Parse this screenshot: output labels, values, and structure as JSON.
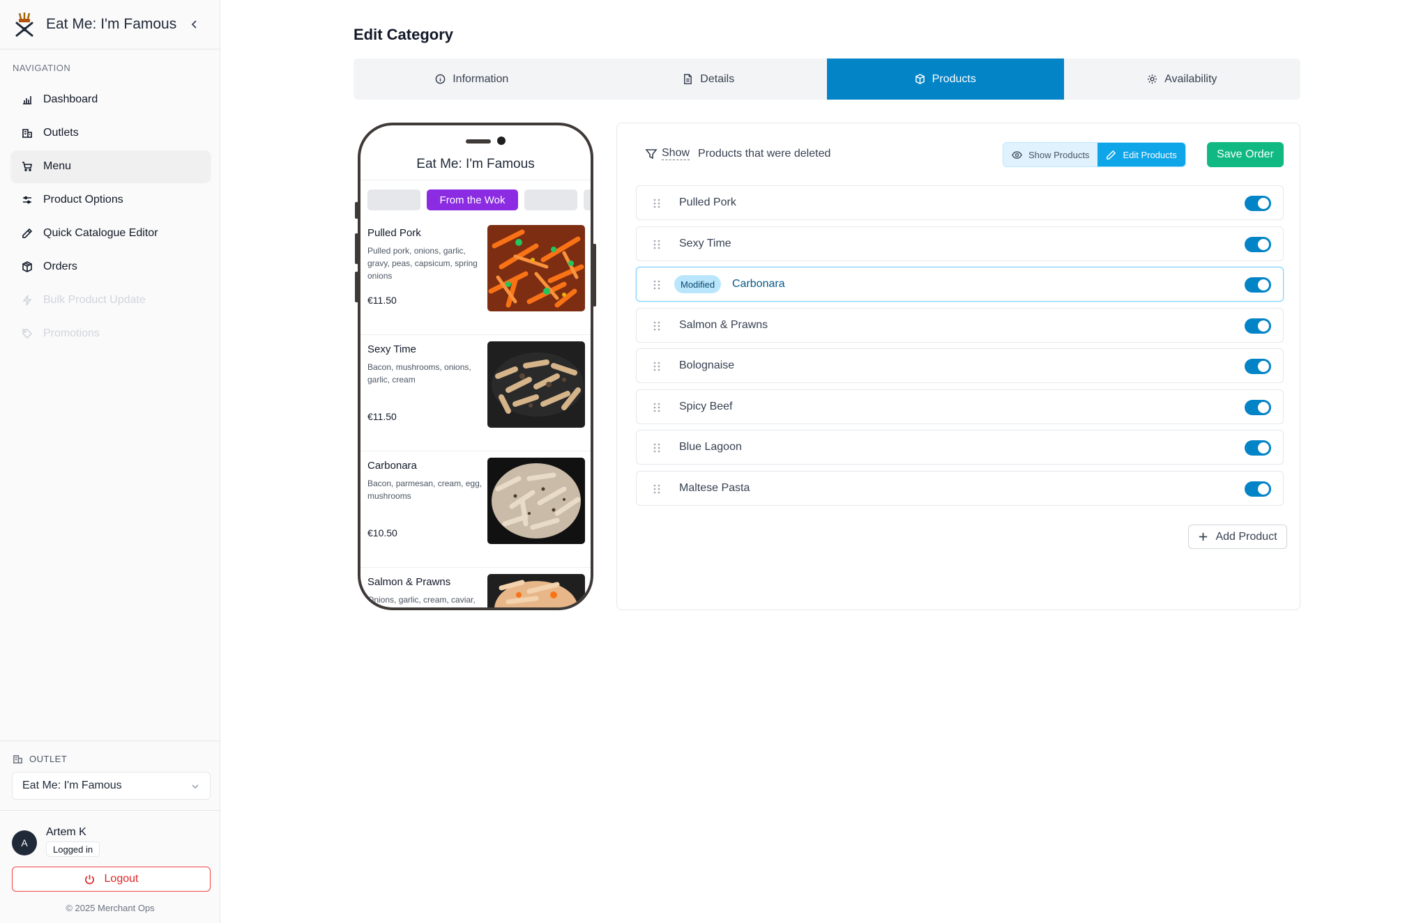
{
  "brand": {
    "title": "Eat Me: I'm Famous"
  },
  "nav": {
    "heading": "NAVIGATION",
    "items": [
      {
        "label": "Dashboard",
        "icon": "bar-chart-icon",
        "state": "normal"
      },
      {
        "label": "Outlets",
        "icon": "building-icon",
        "state": "normal"
      },
      {
        "label": "Menu",
        "icon": "cart-icon",
        "state": "active"
      },
      {
        "label": "Product Options",
        "icon": "sliders-icon",
        "state": "normal"
      },
      {
        "label": "Quick Catalogue Editor",
        "icon": "pencil-icon",
        "state": "normal"
      },
      {
        "label": "Orders",
        "icon": "package-icon",
        "state": "normal"
      },
      {
        "label": "Bulk Product Update",
        "icon": "lightning-icon",
        "state": "disabled"
      },
      {
        "label": "Promotions",
        "icon": "tag-icon",
        "state": "disabled"
      }
    ]
  },
  "outlet": {
    "label": "OUTLET",
    "selected": "Eat Me: I'm Famous"
  },
  "user": {
    "initial": "A",
    "name": "Artem K",
    "status": "Logged in",
    "logout_label": "Logout"
  },
  "footer": {
    "copyright": "© 2025 Merchant Ops"
  },
  "page": {
    "title": "Edit Category"
  },
  "tabs": [
    {
      "label": "Information",
      "icon": "info-icon",
      "active": false
    },
    {
      "label": "Details",
      "icon": "document-icon",
      "active": false
    },
    {
      "label": "Products",
      "icon": "package-icon",
      "active": true
    },
    {
      "label": "Availability",
      "icon": "gear-icon",
      "active": false
    }
  ],
  "preview": {
    "title": "Eat Me: I'm Famous",
    "active_tab": "From the Wok",
    "dishes": [
      {
        "name": "Pulled Pork",
        "desc": "Pulled pork, onions, garlic, gravy, peas, capsicum, spring onions",
        "price": "€11.50"
      },
      {
        "name": "Sexy Time",
        "desc": "Bacon, mushrooms, onions, garlic, cream",
        "price": "€11.50"
      },
      {
        "name": "Carbonara",
        "desc": "Bacon, parmesan, cream, egg, mushrooms",
        "price": "€10.50"
      },
      {
        "name": "Salmon & Prawns",
        "desc": "Onions, garlic, cream, caviar,",
        "price": ""
      }
    ]
  },
  "products_panel": {
    "filter_show": "Show",
    "filter_text": "Products that were deleted",
    "show_products_label": "Show Products",
    "edit_products_label": "Edit Products",
    "save_order_label": "Save Order",
    "modified_label": "Modified",
    "add_product_label": "Add Product",
    "products": [
      {
        "name": "Pulled Pork",
        "enabled": true,
        "modified": false
      },
      {
        "name": "Sexy Time",
        "enabled": true,
        "modified": false
      },
      {
        "name": "Carbonara",
        "enabled": true,
        "modified": true
      },
      {
        "name": "Salmon & Prawns",
        "enabled": true,
        "modified": false
      },
      {
        "name": "Bolognaise",
        "enabled": true,
        "modified": false
      },
      {
        "name": "Spicy Beef",
        "enabled": true,
        "modified": false
      },
      {
        "name": "Blue Lagoon",
        "enabled": true,
        "modified": false
      },
      {
        "name": "Maltese Pasta",
        "enabled": true,
        "modified": false
      }
    ]
  },
  "colors": {
    "accent": "#0284c7",
    "save": "#10b981",
    "logout": "#dc2626",
    "preview_tab": "#8b2be2"
  }
}
